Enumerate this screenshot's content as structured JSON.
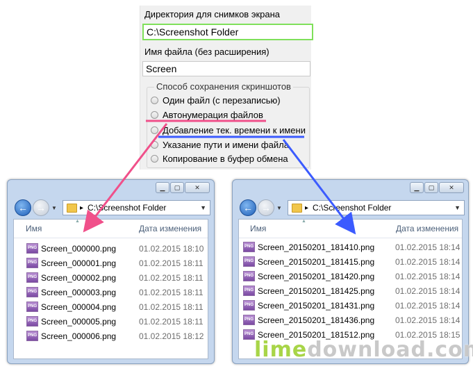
{
  "settings": {
    "dir_label": "Директория для снимков экрана",
    "dir_value": "C:\\Screenshot Folder",
    "filename_label": "Имя файла (без расширения)",
    "filename_value": "Screen",
    "group_title": "Способ сохранения скриншотов",
    "options": [
      {
        "label": "Один файл (с перезаписью)"
      },
      {
        "label": "Автонумерация файлов"
      },
      {
        "label": "Добавление тек. времени к имени"
      },
      {
        "label": "Указание пути и имени файла"
      },
      {
        "label": "Копирование в буфер обмена"
      }
    ]
  },
  "annotation_colors": {
    "left": "#f0508a",
    "right": "#3b5bff"
  },
  "windows": [
    {
      "address": "C:\\Screenshot Folder",
      "col_name": "Имя",
      "col_date": "Дата изменения",
      "icon_text": "PNG",
      "files": [
        {
          "name": "Screen_000000.png",
          "date": "01.02.2015 18:10"
        },
        {
          "name": "Screen_000001.png",
          "date": "01.02.2015 18:11"
        },
        {
          "name": "Screen_000002.png",
          "date": "01.02.2015 18:11"
        },
        {
          "name": "Screen_000003.png",
          "date": "01.02.2015 18:11"
        },
        {
          "name": "Screen_000004.png",
          "date": "01.02.2015 18:11"
        },
        {
          "name": "Screen_000005.png",
          "date": "01.02.2015 18:11"
        },
        {
          "name": "Screen_000006.png",
          "date": "01.02.2015 18:12"
        }
      ]
    },
    {
      "address": "C:\\Screenshot Folder",
      "col_name": "Имя",
      "col_date": "Дата изменения",
      "icon_text": "PNG",
      "files": [
        {
          "name": "Screen_20150201_181410.png",
          "date": "01.02.2015 18:14"
        },
        {
          "name": "Screen_20150201_181415.png",
          "date": "01.02.2015 18:14"
        },
        {
          "name": "Screen_20150201_181420.png",
          "date": "01.02.2015 18:14"
        },
        {
          "name": "Screen_20150201_181425.png",
          "date": "01.02.2015 18:14"
        },
        {
          "name": "Screen_20150201_181431.png",
          "date": "01.02.2015 18:14"
        },
        {
          "name": "Screen_20150201_181436.png",
          "date": "01.02.2015 18:14"
        },
        {
          "name": "Screen_20150201_181512.png",
          "date": "01.02.2015 18:15"
        }
      ]
    }
  ],
  "watermark": {
    "part1": "lime",
    "part2": "download.com"
  }
}
